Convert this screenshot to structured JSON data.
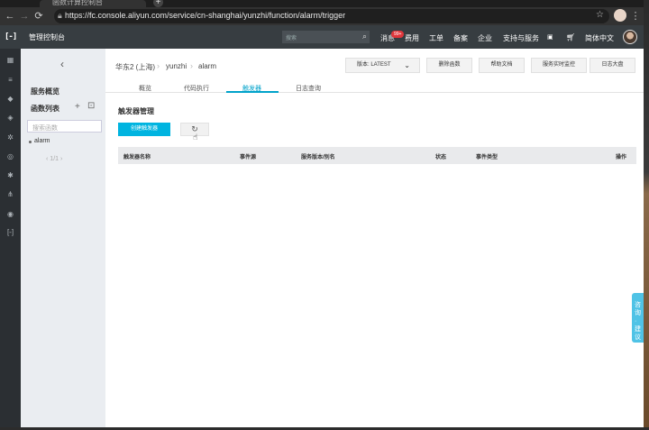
{
  "browser": {
    "tab_title": "函数计算控制台",
    "new_tab": "+",
    "url": "https://fc.console.aliyun.com/service/cn-shanghai/yunzhi/function/alarm/trigger",
    "lock_icon": "lock-icon",
    "star_icon": "star-icon"
  },
  "header": {
    "logo": "[-]",
    "console_title": "管理控制台",
    "search_placeholder": "搜索",
    "messages": "消息",
    "message_badge": "99+",
    "nav": [
      "费用",
      "工单",
      "备案",
      "企业",
      "支持与服务"
    ],
    "language": "简体中文"
  },
  "sidebar": {
    "overview": "服务概览",
    "function_list": "函数列表",
    "search_placeholder": "搜索函数",
    "functions": [
      "alarm"
    ],
    "pager": "1/1"
  },
  "breadcrumb": {
    "region": "华东2 (上海)",
    "service": "yunzhi",
    "function": "alarm"
  },
  "actions": {
    "version": "版本: LATEST",
    "delete": "删除函数",
    "help": "帮助文档",
    "monitor": "服务实时监控",
    "logs": "日志大盘"
  },
  "tabs": [
    "概览",
    "代码执行",
    "触发器",
    "日志查询"
  ],
  "active_tab": "触发器",
  "trigger": {
    "section_title": "触发器管理",
    "create_button": "创建触发器",
    "refresh_icon": "refresh-icon",
    "columns": [
      "触发器名称",
      "事件源",
      "服务版本/别名",
      "状态",
      "事件类型",
      "操作"
    ]
  },
  "feedback": "咨询·建议",
  "colors": {
    "accent": "#00a2ca",
    "primary_button": "#00b4e0",
    "header_bg": "#373d41",
    "badge": "#e0363b"
  }
}
